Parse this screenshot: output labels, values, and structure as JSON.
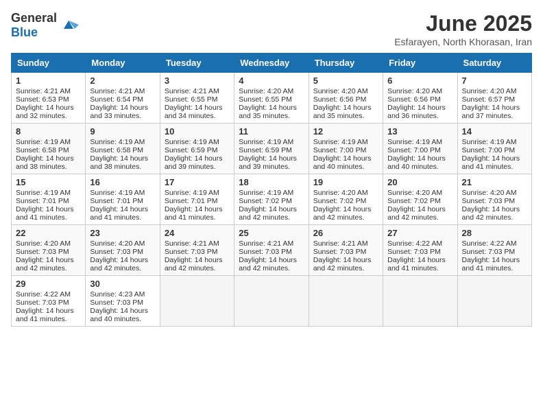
{
  "header": {
    "logo_general": "General",
    "logo_blue": "Blue",
    "month_year": "June 2025",
    "location": "Esfarayen, North Khorasan, Iran"
  },
  "weekdays": [
    "Sunday",
    "Monday",
    "Tuesday",
    "Wednesday",
    "Thursday",
    "Friday",
    "Saturday"
  ],
  "weeks": [
    [
      {
        "day": "1",
        "lines": [
          "Sunrise: 4:21 AM",
          "Sunset: 6:53 PM",
          "Daylight: 14 hours",
          "and 32 minutes."
        ]
      },
      {
        "day": "2",
        "lines": [
          "Sunrise: 4:21 AM",
          "Sunset: 6:54 PM",
          "Daylight: 14 hours",
          "and 33 minutes."
        ]
      },
      {
        "day": "3",
        "lines": [
          "Sunrise: 4:21 AM",
          "Sunset: 6:55 PM",
          "Daylight: 14 hours",
          "and 34 minutes."
        ]
      },
      {
        "day": "4",
        "lines": [
          "Sunrise: 4:20 AM",
          "Sunset: 6:55 PM",
          "Daylight: 14 hours",
          "and 35 minutes."
        ]
      },
      {
        "day": "5",
        "lines": [
          "Sunrise: 4:20 AM",
          "Sunset: 6:56 PM",
          "Daylight: 14 hours",
          "and 35 minutes."
        ]
      },
      {
        "day": "6",
        "lines": [
          "Sunrise: 4:20 AM",
          "Sunset: 6:56 PM",
          "Daylight: 14 hours",
          "and 36 minutes."
        ]
      },
      {
        "day": "7",
        "lines": [
          "Sunrise: 4:20 AM",
          "Sunset: 6:57 PM",
          "Daylight: 14 hours",
          "and 37 minutes."
        ]
      }
    ],
    [
      {
        "day": "8",
        "lines": [
          "Sunrise: 4:19 AM",
          "Sunset: 6:58 PM",
          "Daylight: 14 hours",
          "and 38 minutes."
        ]
      },
      {
        "day": "9",
        "lines": [
          "Sunrise: 4:19 AM",
          "Sunset: 6:58 PM",
          "Daylight: 14 hours",
          "and 38 minutes."
        ]
      },
      {
        "day": "10",
        "lines": [
          "Sunrise: 4:19 AM",
          "Sunset: 6:59 PM",
          "Daylight: 14 hours",
          "and 39 minutes."
        ]
      },
      {
        "day": "11",
        "lines": [
          "Sunrise: 4:19 AM",
          "Sunset: 6:59 PM",
          "Daylight: 14 hours",
          "and 39 minutes."
        ]
      },
      {
        "day": "12",
        "lines": [
          "Sunrise: 4:19 AM",
          "Sunset: 7:00 PM",
          "Daylight: 14 hours",
          "and 40 minutes."
        ]
      },
      {
        "day": "13",
        "lines": [
          "Sunrise: 4:19 AM",
          "Sunset: 7:00 PM",
          "Daylight: 14 hours",
          "and 40 minutes."
        ]
      },
      {
        "day": "14",
        "lines": [
          "Sunrise: 4:19 AM",
          "Sunset: 7:00 PM",
          "Daylight: 14 hours",
          "and 41 minutes."
        ]
      }
    ],
    [
      {
        "day": "15",
        "lines": [
          "Sunrise: 4:19 AM",
          "Sunset: 7:01 PM",
          "Daylight: 14 hours",
          "and 41 minutes."
        ]
      },
      {
        "day": "16",
        "lines": [
          "Sunrise: 4:19 AM",
          "Sunset: 7:01 PM",
          "Daylight: 14 hours",
          "and 41 minutes."
        ]
      },
      {
        "day": "17",
        "lines": [
          "Sunrise: 4:19 AM",
          "Sunset: 7:01 PM",
          "Daylight: 14 hours",
          "and 41 minutes."
        ]
      },
      {
        "day": "18",
        "lines": [
          "Sunrise: 4:19 AM",
          "Sunset: 7:02 PM",
          "Daylight: 14 hours",
          "and 42 minutes."
        ]
      },
      {
        "day": "19",
        "lines": [
          "Sunrise: 4:20 AM",
          "Sunset: 7:02 PM",
          "Daylight: 14 hours",
          "and 42 minutes."
        ]
      },
      {
        "day": "20",
        "lines": [
          "Sunrise: 4:20 AM",
          "Sunset: 7:02 PM",
          "Daylight: 14 hours",
          "and 42 minutes."
        ]
      },
      {
        "day": "21",
        "lines": [
          "Sunrise: 4:20 AM",
          "Sunset: 7:03 PM",
          "Daylight: 14 hours",
          "and 42 minutes."
        ]
      }
    ],
    [
      {
        "day": "22",
        "lines": [
          "Sunrise: 4:20 AM",
          "Sunset: 7:03 PM",
          "Daylight: 14 hours",
          "and 42 minutes."
        ]
      },
      {
        "day": "23",
        "lines": [
          "Sunrise: 4:20 AM",
          "Sunset: 7:03 PM",
          "Daylight: 14 hours",
          "and 42 minutes."
        ]
      },
      {
        "day": "24",
        "lines": [
          "Sunrise: 4:21 AM",
          "Sunset: 7:03 PM",
          "Daylight: 14 hours",
          "and 42 minutes."
        ]
      },
      {
        "day": "25",
        "lines": [
          "Sunrise: 4:21 AM",
          "Sunset: 7:03 PM",
          "Daylight: 14 hours",
          "and 42 minutes."
        ]
      },
      {
        "day": "26",
        "lines": [
          "Sunrise: 4:21 AM",
          "Sunset: 7:03 PM",
          "Daylight: 14 hours",
          "and 42 minutes."
        ]
      },
      {
        "day": "27",
        "lines": [
          "Sunrise: 4:22 AM",
          "Sunset: 7:03 PM",
          "Daylight: 14 hours",
          "and 41 minutes."
        ]
      },
      {
        "day": "28",
        "lines": [
          "Sunrise: 4:22 AM",
          "Sunset: 7:03 PM",
          "Daylight: 14 hours",
          "and 41 minutes."
        ]
      }
    ],
    [
      {
        "day": "29",
        "lines": [
          "Sunrise: 4:22 AM",
          "Sunset: 7:03 PM",
          "Daylight: 14 hours",
          "and 41 minutes."
        ]
      },
      {
        "day": "30",
        "lines": [
          "Sunrise: 4:23 AM",
          "Sunset: 7:03 PM",
          "Daylight: 14 hours",
          "and 40 minutes."
        ]
      },
      {
        "day": "",
        "lines": []
      },
      {
        "day": "",
        "lines": []
      },
      {
        "day": "",
        "lines": []
      },
      {
        "day": "",
        "lines": []
      },
      {
        "day": "",
        "lines": []
      }
    ]
  ]
}
